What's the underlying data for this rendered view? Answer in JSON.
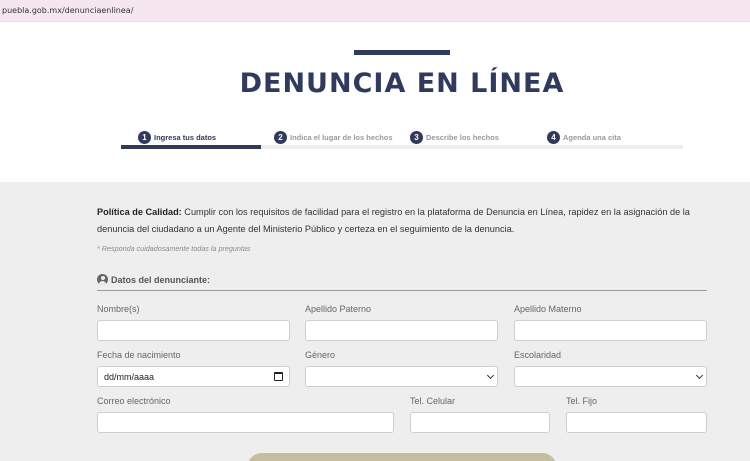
{
  "browser": {
    "url": "puebla.gob.mx/denunciaenlinea/"
  },
  "header": {
    "title": "DENUNCIA EN LÍNEA"
  },
  "steps": [
    {
      "number": "1",
      "label": "Ingresa tus datos",
      "active": true
    },
    {
      "number": "2",
      "label": "Indica el lugar de los hechos",
      "active": false
    },
    {
      "number": "3",
      "label": "Describe los hechos",
      "active": false
    },
    {
      "number": "4",
      "label": "Agenda una cita",
      "active": false
    }
  ],
  "policy": {
    "label": "Política de Calidad:",
    "text": " Cumplir con los requisitos de facilidad para el registro en la plataforma de Denuncia en Línea, rapidez en la asignación de la denuncia del ciudadano a un Agente del Ministerio Público y certeza en el seguimiento de la denuncia."
  },
  "hint": "* Responda cuidadosamente todas la preguntas",
  "section": {
    "title": "Datos del denunciante:",
    "icon": "user-circle-icon"
  },
  "fields": {
    "nombre": {
      "label": "Nombre(s)",
      "value": ""
    },
    "apellido_paterno": {
      "label": "Apellido Paterno",
      "value": ""
    },
    "apellido_materno": {
      "label": "Apellido Materno",
      "value": ""
    },
    "fecha_nacimiento": {
      "label": "Fecha de nacimiento",
      "value": "dd/mm/aaaa"
    },
    "genero": {
      "label": "Género",
      "value": ""
    },
    "escolaridad": {
      "label": "Escolaridad",
      "value": ""
    },
    "correo": {
      "label": "Correo electrónico",
      "value": ""
    },
    "tel_celular": {
      "label": "Tel. Celular",
      "value": ""
    },
    "tel_fijo": {
      "label": "Tel. Fijo",
      "value": ""
    }
  },
  "colors": {
    "primary": "#2f3a5c",
    "form_bg": "#eeeeee",
    "button": "#c4bda0"
  }
}
